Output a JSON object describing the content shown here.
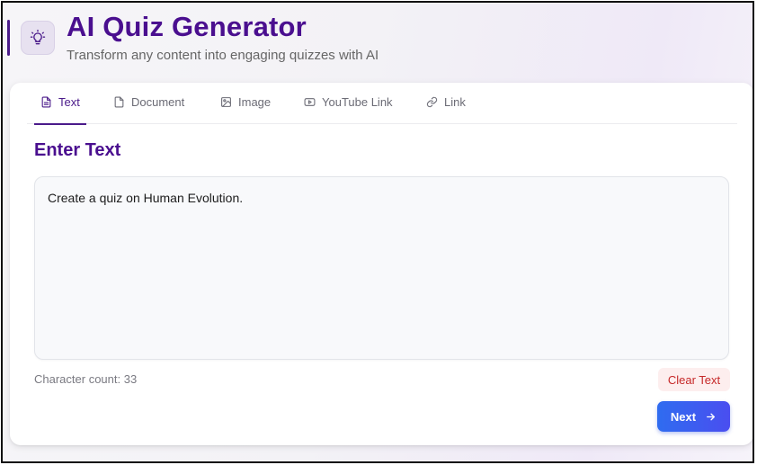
{
  "header": {
    "title": "AI Quiz Generator",
    "subtitle": "Transform any content into engaging quizzes with AI",
    "logo_icon": "lightbulb-icon"
  },
  "tabs": [
    {
      "label": "Text",
      "icon": "file-text-icon",
      "active": true
    },
    {
      "label": "Document",
      "icon": "file-icon",
      "active": false
    },
    {
      "label": "Image",
      "icon": "image-icon",
      "active": false
    },
    {
      "label": "YouTube Link",
      "icon": "youtube-icon",
      "active": false
    },
    {
      "label": "Link",
      "icon": "link-icon",
      "active": false
    }
  ],
  "main": {
    "section_title": "Enter Text",
    "text_input_value": "Create a quiz on Human Evolution.",
    "char_count": "Character count: 33",
    "clear_label": "Clear Text",
    "next_label": "Next"
  },
  "colors": {
    "brand": "#4a0f8f",
    "accent": "#3b5cf0",
    "danger": "#c62828"
  }
}
